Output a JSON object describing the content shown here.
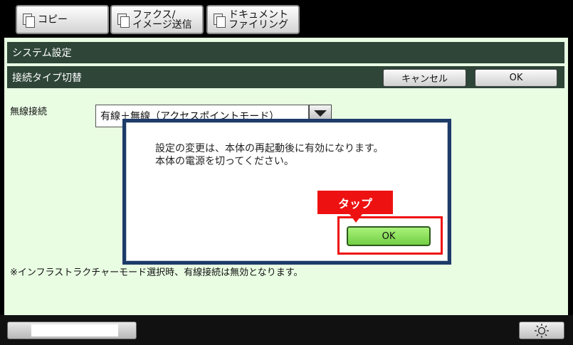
{
  "tabs": [
    {
      "label": "コピー",
      "icon": "copy-icon"
    },
    {
      "label": "ファクス/\nイメージ送信",
      "icon": "fax-icon"
    },
    {
      "label": "ドキュメント\nファイリング",
      "icon": "document-filing-icon"
    }
  ],
  "header": {
    "title": "システム設定"
  },
  "subheader": {
    "title": "接続タイプ切替",
    "cancel_label": "キャンセル",
    "ok_label": "OK"
  },
  "setting": {
    "label": "無線接続",
    "value": "有線＋無線（アクセスポイントモード）"
  },
  "note": "※インフラストラクチャーモード選択時、有線接続は無効となります。",
  "dialog": {
    "line1": "設定の変更は、本体の再起動後に有効になります。",
    "line2": "本体の電源を切ってください。",
    "ok_label": "OK"
  },
  "annotation": {
    "label": "タップ",
    "color": "#ee1111"
  },
  "colors": {
    "header_bar": "#2e4538",
    "main_bg": "#e9fde3",
    "dialog_border": "#1d3b69",
    "ok_button": "#8ee35e"
  }
}
